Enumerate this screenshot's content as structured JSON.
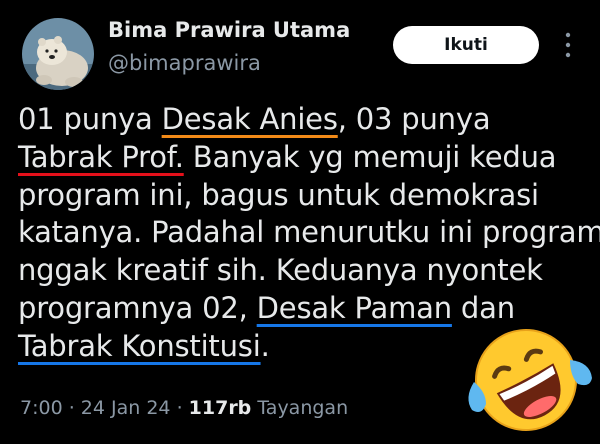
{
  "author": {
    "name": "Bima Prawira Utama",
    "handle": "@bimaprawira"
  },
  "follow_button": "Ikuti",
  "more_icon": "more-vertical-icon",
  "tweet": {
    "line1_a": "01 punya ",
    "line1_b": "Desak Anies",
    "line1_c": ", 03 punya",
    "line2_a": "Tabrak Prof.",
    "line2_b": " Banyak yg memuji kedua",
    "line3": "program ini, bagus untuk demokrasi",
    "line4": "katanya. Padahal menurutku ini program",
    "line5": "nggak kreatif sih. Keduanya nyontek",
    "line6_a": "programnya 02, ",
    "line6_b": "Desak Paman",
    "line6_c": " dan",
    "line7_a": "Tabrak Konstitusi",
    "line7_b": "."
  },
  "meta": {
    "time": "7:00",
    "sep1": " · ",
    "date": "24 Jan 24",
    "sep2": " · ",
    "views": "117rb",
    "views_label": " Tayangan"
  },
  "emoji": "rolling-on-floor-laughing-emoji",
  "colors": {
    "background": "#000000",
    "text": "#e7e9ea",
    "secondary": "#8b98a5",
    "underline_orange": "#f28a18",
    "underline_red": "#e5101a",
    "underline_blue": "#1677e8"
  }
}
